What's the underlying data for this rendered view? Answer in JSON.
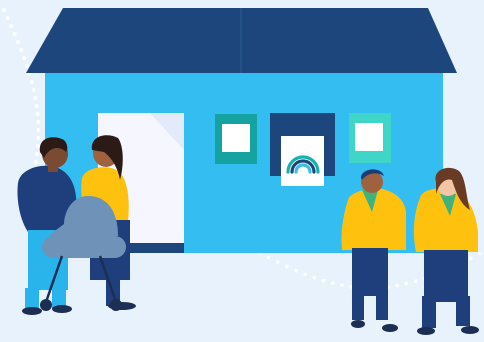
{
  "palette": {
    "background": "#e7f2fc",
    "roof": "#1d477c",
    "wall": "#33bdf0",
    "door": "#f5f6ff",
    "teal_window": "#14a3a1",
    "mint_window": "#3fd6c9",
    "window_pane": "#ffffff",
    "poster_frame": "#1d477c",
    "rainbow_teal": "#17b1ad",
    "rainbow_navy": "#1d477c",
    "rainbow_blue": "#3bbfe8",
    "dots": "#ffffff",
    "uniform_yellow": "#fec20e",
    "trousers_navy": "#1f3e7c",
    "neckerchief_green": "#3fb27f",
    "stroller": "#6f92b8",
    "skin_dark": "#7a4a33",
    "skin_medium": "#a0613e",
    "skin_light": "#f2c6a5",
    "hair_dark": "#2b1a15",
    "hair_brown": "#6a3b24",
    "hair_navy": "#1d3c72"
  },
  "icons": {
    "poster": "rainbow-icon"
  }
}
